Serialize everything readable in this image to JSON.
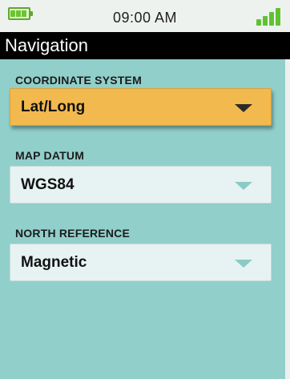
{
  "status_bar": {
    "time": "09:00 AM",
    "battery_icon": "battery-icon",
    "signal_icon": "signal-strength-icon",
    "battery_color": "#6bc531",
    "signal_color": "#5fc233"
  },
  "header": {
    "title": "Navigation"
  },
  "settings": [
    {
      "label": "COORDINATE SYSTEM",
      "value": "Lat/Long",
      "selected": true
    },
    {
      "label": "MAP DATUM",
      "value": "WGS84",
      "selected": false
    },
    {
      "label": "NORTH REFERENCE",
      "value": "Magnetic",
      "selected": false
    }
  ],
  "colors": {
    "background": "#91cfcb",
    "selected": "#f1b94e",
    "dropdown": "#e6f3f2"
  }
}
